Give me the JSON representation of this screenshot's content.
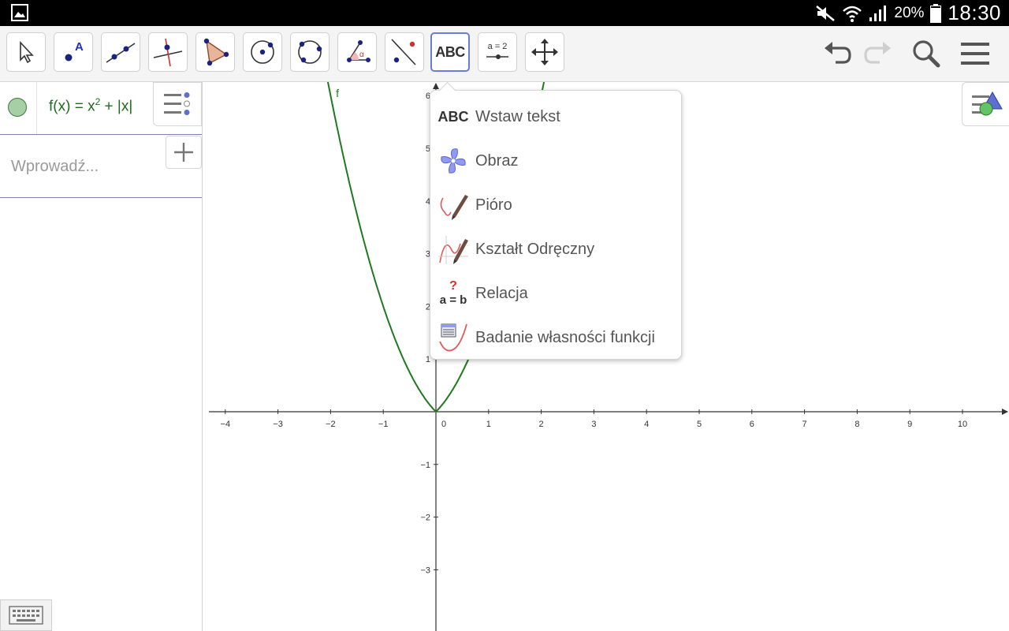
{
  "status_bar": {
    "battery": "20%",
    "time": "18:30",
    "icons": [
      "gallery-icon",
      "mute-icon",
      "wifi-icon",
      "signal-icon",
      "battery-icon"
    ]
  },
  "toolbar": {
    "tools": [
      {
        "name": "move-tool",
        "icon": "arrow-cursor-icon"
      },
      {
        "name": "point-tool",
        "icon": "point-a-icon",
        "label": "A"
      },
      {
        "name": "line-tool",
        "icon": "line-through-points-icon"
      },
      {
        "name": "perpendicular-line-tool",
        "icon": "perpendicular-icon"
      },
      {
        "name": "polygon-tool",
        "icon": "polygon-icon"
      },
      {
        "name": "circle-center-tool",
        "icon": "circle-center-icon"
      },
      {
        "name": "circle-three-points-tool",
        "icon": "circle-three-points-icon"
      },
      {
        "name": "angle-tool",
        "icon": "angle-icon",
        "label": "α"
      },
      {
        "name": "reflect-tool",
        "icon": "reflect-line-icon"
      },
      {
        "name": "text-tool",
        "icon": "abc-text-icon",
        "label": "ABC",
        "active": true
      },
      {
        "name": "slider-tool",
        "icon": "slider-icon",
        "label": "a = 2"
      },
      {
        "name": "move-graphics-tool",
        "icon": "move-arrows-icon"
      }
    ],
    "right": [
      "undo-icon",
      "redo-icon",
      "search-icon",
      "hamburger-menu-icon"
    ],
    "accent": "#6a7bd8"
  },
  "algebra": {
    "formula_prefix": "f(x) = x",
    "formula_exp": "2",
    "formula_suffix": " + |x|",
    "input_placeholder": "Wprowadź...",
    "function_color": "#1f6b1f"
  },
  "graphics": {
    "function_label": "f",
    "x_ticks": [
      "−4",
      "−3",
      "−2",
      "−1",
      "0",
      "1",
      "2",
      "3",
      "4",
      "5",
      "6",
      "7",
      "8",
      "9",
      "10"
    ],
    "y_ticks": [
      "6",
      "5",
      "4",
      "3",
      "2",
      "1",
      "−1",
      "−2",
      "−3"
    ],
    "curve_color": "#1f7a1f"
  },
  "chart_data": {
    "type": "line",
    "function": "f(x) = x^2 + |x|",
    "x": [
      -2.0,
      -1.5,
      -1.0,
      -0.5,
      0,
      0.5,
      1.0,
      1.5,
      2.0
    ],
    "y": [
      6.0,
      3.75,
      2.0,
      0.75,
      0,
      0.75,
      2.0,
      3.75,
      6.0
    ],
    "xlim": [
      -4.3,
      10.8
    ],
    "ylim": [
      -4.2,
      6.3
    ],
    "grid": false
  },
  "menu": {
    "items": [
      {
        "label": "Wstaw tekst",
        "icon": "abc-text-icon"
      },
      {
        "label": "Obraz",
        "icon": "image-pinwheel-icon"
      },
      {
        "label": "Pióro",
        "icon": "pen-icon"
      },
      {
        "label": "Kształt Odręczny",
        "icon": "freehand-shape-icon"
      },
      {
        "label": "Relacja",
        "icon": "relation-icon"
      },
      {
        "label": "Badanie własności funkcji",
        "icon": "function-inspector-icon"
      }
    ],
    "abc_icon_text": "ABC",
    "relation_icon_text": "a = b",
    "relation_question": "?"
  }
}
